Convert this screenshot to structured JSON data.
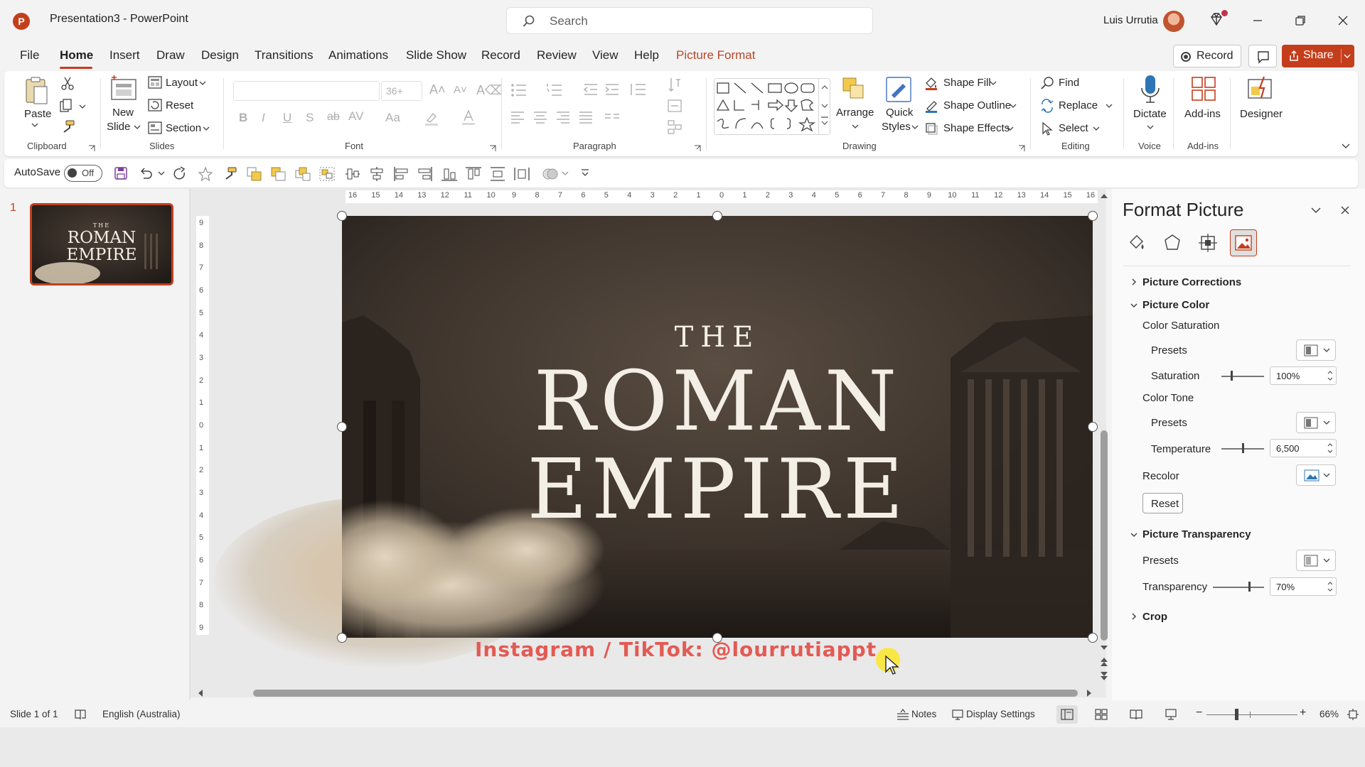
{
  "window": {
    "title": "Presentation3  -  PowerPoint",
    "search_placeholder": "Search",
    "user": "Luis Urrutia"
  },
  "menu": {
    "items": [
      "File",
      "Home",
      "Insert",
      "Draw",
      "Design",
      "Transitions",
      "Animations",
      "Slide Show",
      "Record",
      "Review",
      "View",
      "Help",
      "Picture Format"
    ],
    "active": "Home",
    "record": "Record",
    "share": "Share"
  },
  "ribbon": {
    "clipboard": {
      "paste": "Paste",
      "label": "Clipboard"
    },
    "slides": {
      "new_slide_1": "New",
      "new_slide_2": "Slide",
      "layout": "Layout",
      "reset": "Reset",
      "section": "Section",
      "label": "Slides"
    },
    "font": {
      "label": "Font",
      "size": "36+"
    },
    "paragraph": {
      "label": "Paragraph"
    },
    "drawing": {
      "arrange": "Arrange",
      "quick_styles_1": "Quick",
      "quick_styles_2": "Styles",
      "shape_fill": "Shape Fill",
      "shape_outline": "Shape Outline",
      "shape_effects": "Shape Effects",
      "label": "Drawing"
    },
    "editing": {
      "find": "Find",
      "replace": "Replace",
      "select": "Select",
      "label": "Editing"
    },
    "voice": {
      "dictate": "Dictate",
      "label": "Voice"
    },
    "addins": {
      "addins": "Add-ins",
      "label": "Add-ins"
    },
    "designer": {
      "designer": "Designer"
    }
  },
  "qat": {
    "autosave": "AutoSave",
    "toggle": "Off"
  },
  "slides_panel": {
    "number": "1"
  },
  "slide": {
    "line1": "THE",
    "line2": "ROMAN",
    "line3": "EMPIRE",
    "watermark": "Instagram / TikTok: @lourrutiappt"
  },
  "rulers": {
    "h": [
      "16",
      "15",
      "14",
      "13",
      "12",
      "11",
      "10",
      "9",
      "8",
      "7",
      "6",
      "5",
      "4",
      "3",
      "2",
      "1",
      "0",
      "1",
      "2",
      "3",
      "4",
      "5",
      "6",
      "7",
      "8",
      "9",
      "10",
      "11",
      "12",
      "13",
      "14",
      "15",
      "16"
    ],
    "v": [
      "9",
      "8",
      "7",
      "6",
      "5",
      "4",
      "3",
      "2",
      "1",
      "0",
      "1",
      "2",
      "3",
      "4",
      "5",
      "6",
      "7",
      "8",
      "9"
    ]
  },
  "format_pane": {
    "title": "Format Picture",
    "picture_corrections": "Picture Corrections",
    "picture_color": "Picture Color",
    "color_saturation": "Color Saturation",
    "presets": "Presets",
    "saturation": "Saturation",
    "saturation_value": "100%",
    "color_tone": "Color Tone",
    "temperature": "Temperature",
    "temperature_value": "6,500",
    "recolor": "Recolor",
    "reset": "Reset",
    "picture_transparency": "Picture Transparency",
    "transparency": "Transparency",
    "transparency_value": "70%",
    "crop": "Crop"
  },
  "status": {
    "slide": "Slide 1 of 1",
    "language": "English (Australia)",
    "notes": "Notes",
    "display": "Display Settings",
    "zoom": "66%"
  },
  "colors": {
    "accent": "#c43e1c",
    "watermark": "#e35a54",
    "slide_bg": "#3d342c"
  }
}
